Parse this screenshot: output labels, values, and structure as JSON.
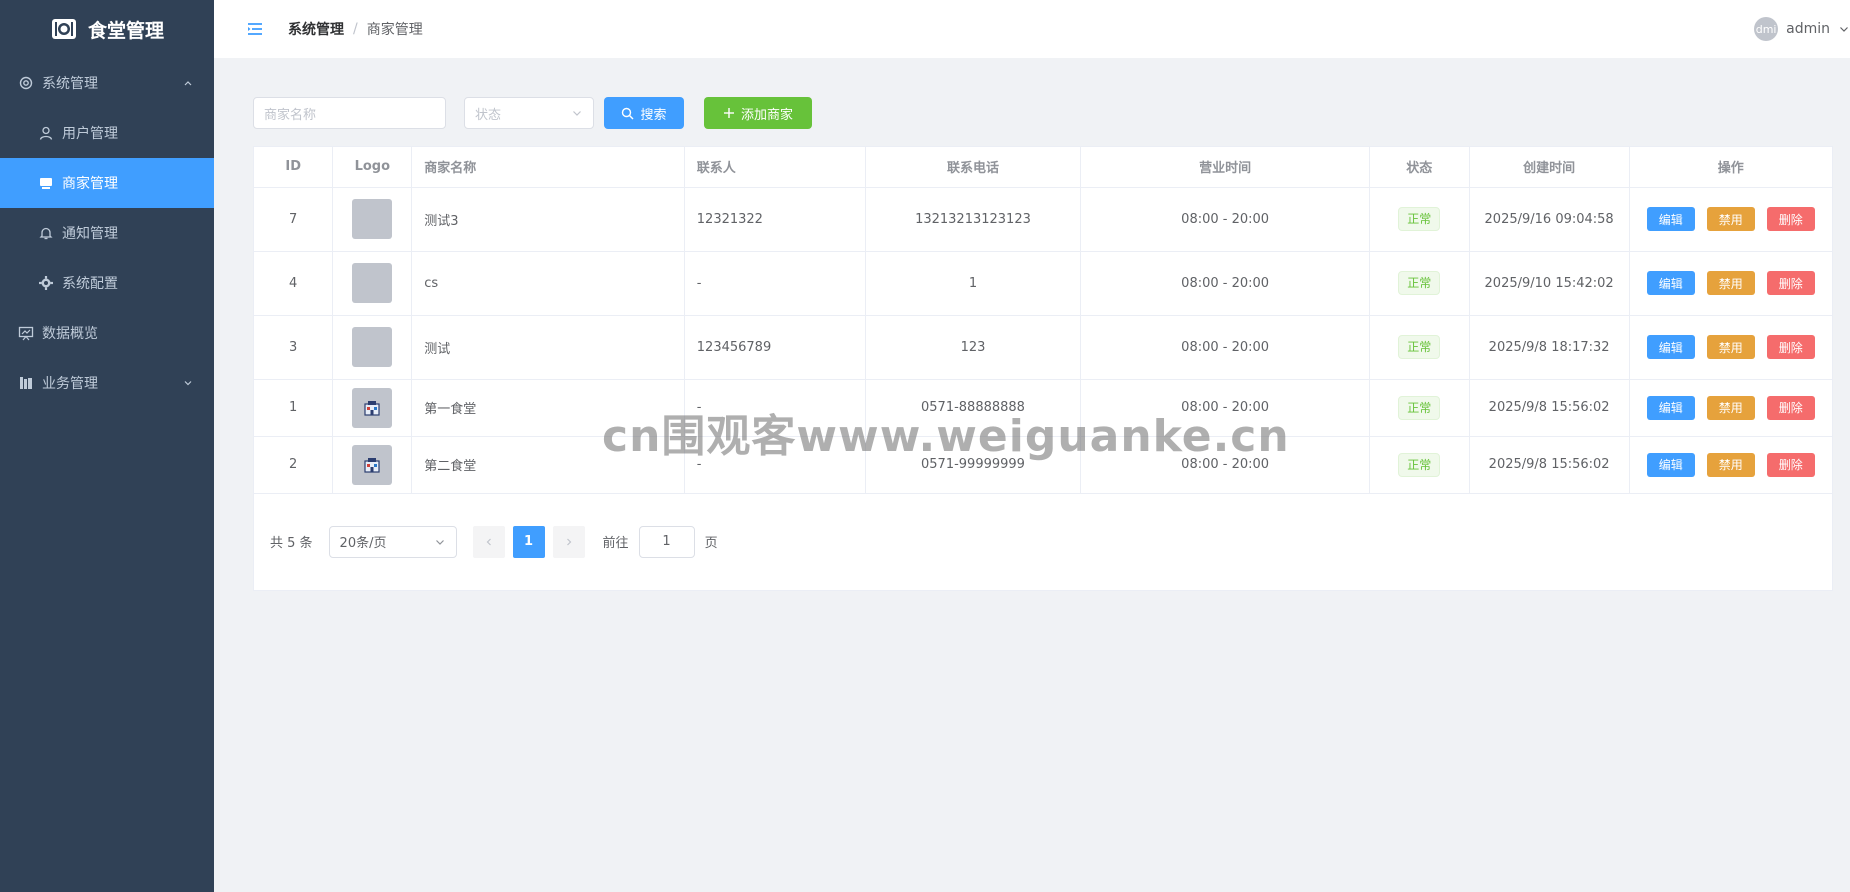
{
  "app": {
    "title": "食堂管理"
  },
  "sidebar": {
    "items": [
      {
        "label": "系统管理",
        "icon": "gear-icon",
        "type": "group",
        "expanded": true
      },
      {
        "label": "用户管理",
        "icon": "user-icon",
        "type": "sub"
      },
      {
        "label": "商家管理",
        "icon": "shop-icon",
        "type": "sub",
        "active": true
      },
      {
        "label": "通知管理",
        "icon": "bell-icon",
        "type": "sub"
      },
      {
        "label": "系统配置",
        "icon": "cog-icon",
        "type": "sub"
      },
      {
        "label": "数据概览",
        "icon": "chart-board-icon",
        "type": "group"
      },
      {
        "label": "业务管理",
        "icon": "books-icon",
        "type": "group",
        "expanded": false
      }
    ]
  },
  "header": {
    "breadcrumb": [
      "系统管理",
      "商家管理"
    ],
    "breadcrumb_sep": "/",
    "user": {
      "avatar_text": "dmi",
      "name": "admin"
    }
  },
  "filters": {
    "name_placeholder": "商家名称",
    "status_placeholder": "状态",
    "search_label": "搜索",
    "add_label": "添加商家"
  },
  "table": {
    "columns": [
      "ID",
      "Logo",
      "商家名称",
      "联系人",
      "联系电话",
      "营业时间",
      "状态",
      "创建时间",
      "操作"
    ],
    "rows": [
      {
        "id": "7",
        "logo": "placeholder",
        "name": "测试3",
        "contact": "12321322",
        "phone": "13213213123123",
        "hours": "08:00 - 20:00",
        "status": "正常",
        "created": "2025/9/16 09:04:58"
      },
      {
        "id": "4",
        "logo": "placeholder",
        "name": "cs",
        "contact": "-",
        "phone": "1",
        "hours": "08:00 - 20:00",
        "status": "正常",
        "created": "2025/9/10 15:42:02"
      },
      {
        "id": "3",
        "logo": "placeholder",
        "name": "测试",
        "contact": "123456789",
        "phone": "123",
        "hours": "08:00 - 20:00",
        "status": "正常",
        "created": "2025/9/8 18:17:32"
      },
      {
        "id": "1",
        "logo": "image",
        "name": "第一食堂",
        "contact": "-",
        "phone": "0571-88888888",
        "hours": "08:00 - 20:00",
        "status": "正常",
        "created": "2025/9/8 15:56:02"
      },
      {
        "id": "2",
        "logo": "image",
        "name": "第二食堂",
        "contact": "-",
        "phone": "0571-99999999",
        "hours": "08:00 - 20:00",
        "status": "正常",
        "created": "2025/9/8 15:56:02"
      }
    ],
    "actions": {
      "edit": "编辑",
      "disable": "禁用",
      "delete": "删除"
    }
  },
  "pagination": {
    "total_text": "共 5 条",
    "page_size": "20条/页",
    "current_page": "1",
    "goto_label": "前往",
    "goto_value": "1",
    "page_suffix": "页"
  },
  "watermark": "cn围观客www.weiguanke.cn",
  "colors": {
    "sidebar_bg": "#304156",
    "primary": "#409eff",
    "success": "#67c23a",
    "warning": "#e6a23c",
    "danger": "#f56c6c"
  }
}
